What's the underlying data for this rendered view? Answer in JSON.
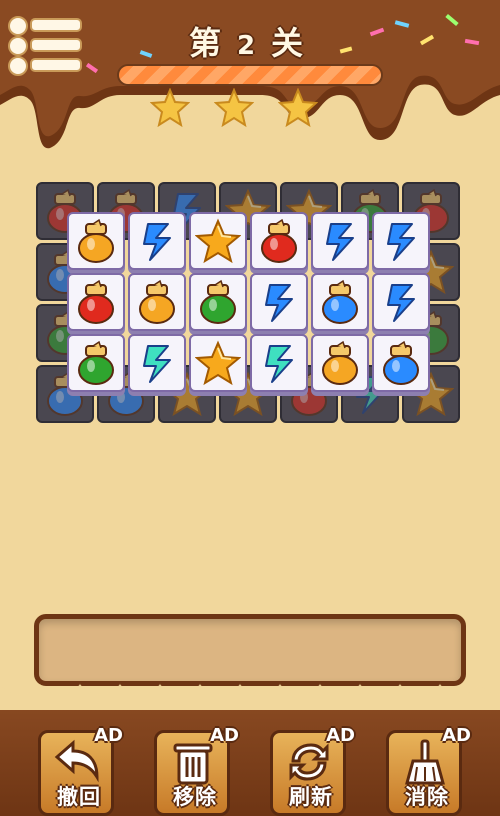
{
  "header": {
    "level_prefix": "第",
    "level_number": "2",
    "level_suffix": "关",
    "progress": 1.0,
    "stars_earned": 3,
    "stars_total": 3
  },
  "board": {
    "top_rows": [
      [
        "jar-orange",
        "swirl-blue",
        "star",
        "jar-red",
        "swirl-blue",
        "swirl-blue"
      ],
      [
        "jar-red",
        "jar-orange",
        "jar-green",
        "swirl-blue",
        "jar-blue",
        "swirl-blue"
      ],
      [
        "jar-green",
        "swirl-teal",
        "star",
        "swirl-teal",
        "jar-orange",
        "jar-blue"
      ]
    ],
    "under_rows": [
      [
        "jar-red",
        "jar-red",
        "swirl-blue",
        "star",
        "star",
        "jar-green",
        "jar-red"
      ],
      [
        "jar-blue",
        "",
        "",
        "",
        "",
        "",
        "star"
      ],
      [
        "jar-green",
        "",
        "",
        "",
        "",
        "",
        "jar-green"
      ],
      [
        "jar-blue",
        "jar-blue",
        "star",
        "star",
        "jar-red",
        "swirl-teal",
        "star"
      ]
    ]
  },
  "tools": [
    {
      "name": "undo",
      "label": "撤回",
      "badge": "AD",
      "icon": "undo-arrow-icon"
    },
    {
      "name": "remove",
      "label": "移除",
      "badge": "AD",
      "icon": "trash-icon"
    },
    {
      "name": "refresh",
      "label": "刷新",
      "badge": "AD",
      "icon": "refresh-icon"
    },
    {
      "name": "clear",
      "label": "消除",
      "badge": "AD",
      "icon": "broom-icon"
    }
  ],
  "colors": {
    "background": "#f1d79c",
    "chocolate": "#6e3514",
    "progress": "#ff8a3c",
    "star": "#f5b325"
  }
}
